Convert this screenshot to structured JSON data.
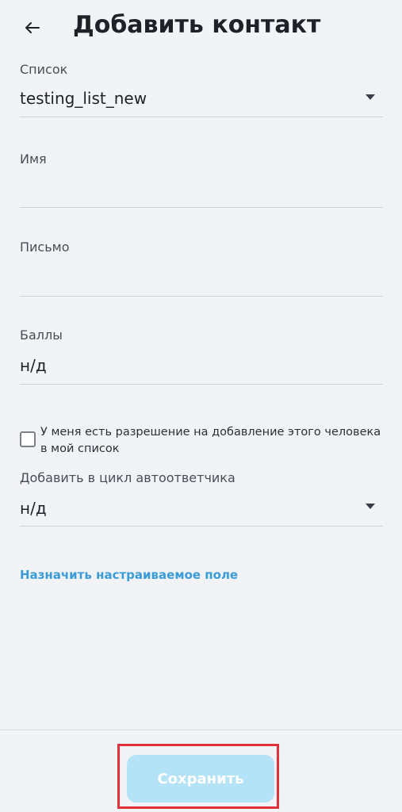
{
  "header": {
    "title": "Добавить контакт",
    "back_icon": "arrow-left-icon"
  },
  "form": {
    "list": {
      "label": "Список",
      "value": "testing_list_new",
      "icon": "dropdown-caret-icon"
    },
    "name": {
      "label": "Имя",
      "value": ""
    },
    "email": {
      "label": "Письмо",
      "value": ""
    },
    "score": {
      "label": "Баллы",
      "value": "н/д"
    },
    "permission": {
      "label": "У меня есть разрешение на добавление этого человека в мой список",
      "checked": false
    },
    "autoresponder": {
      "label": "Добавить в цикл автоответчика",
      "value": "н/д",
      "icon": "dropdown-caret-icon"
    },
    "custom_field_link": "Назначить настраиваемое поле"
  },
  "footer": {
    "save_label": "Сохранить"
  },
  "colors": {
    "background": "#f2f3f7",
    "link": "#3a9bd9",
    "save_button": "#b4e2f6",
    "highlight": "#e0303a"
  }
}
